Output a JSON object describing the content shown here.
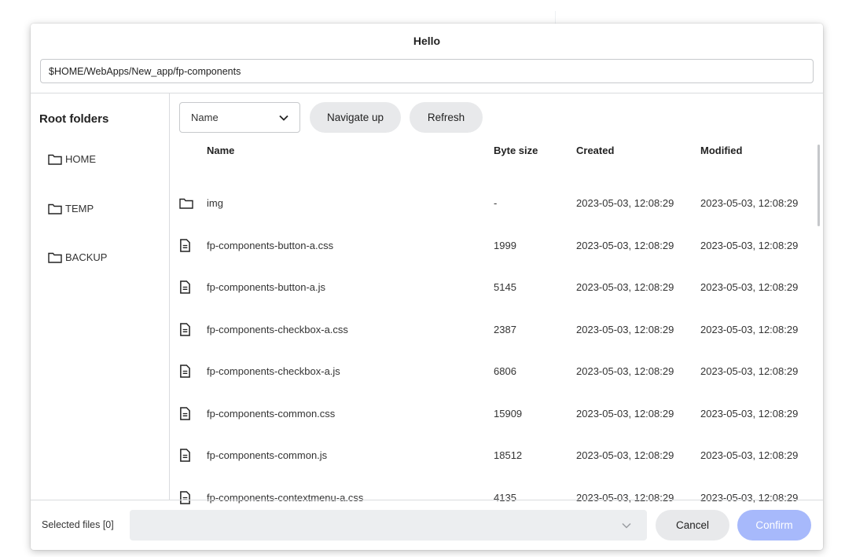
{
  "dialog": {
    "title": "Hello",
    "path_value": "$HOME/WebApps/New_app/fp-components"
  },
  "sidebar": {
    "title": "Root folders",
    "items": [
      {
        "label": "HOME",
        "icon": "folder-icon"
      },
      {
        "label": "TEMP",
        "icon": "folder-icon"
      },
      {
        "label": "BACKUP",
        "icon": "folder-icon"
      }
    ]
  },
  "toolbar": {
    "sort_value": "Name",
    "navigate_up_label": "Navigate up",
    "refresh_label": "Refresh"
  },
  "table": {
    "headers": {
      "name": "Name",
      "size": "Byte size",
      "created": "Created",
      "modified": "Modified"
    },
    "rows": [
      {
        "type": "folder",
        "name": "img",
        "size": "-",
        "created": "2023-05-03, 12:08:29",
        "modified": "2023-05-03, 12:08:29"
      },
      {
        "type": "file",
        "name": "fp-components-button-a.css",
        "size": "1999",
        "created": "2023-05-03, 12:08:29",
        "modified": "2023-05-03, 12:08:29"
      },
      {
        "type": "file",
        "name": "fp-components-button-a.js",
        "size": "5145",
        "created": "2023-05-03, 12:08:29",
        "modified": "2023-05-03, 12:08:29"
      },
      {
        "type": "file",
        "name": "fp-components-checkbox-a.css",
        "size": "2387",
        "created": "2023-05-03, 12:08:29",
        "modified": "2023-05-03, 12:08:29"
      },
      {
        "type": "file",
        "name": "fp-components-checkbox-a.js",
        "size": "6806",
        "created": "2023-05-03, 12:08:29",
        "modified": "2023-05-03, 12:08:29"
      },
      {
        "type": "file",
        "name": "fp-components-common.css",
        "size": "15909",
        "created": "2023-05-03, 12:08:29",
        "modified": "2023-05-03, 12:08:29"
      },
      {
        "type": "file",
        "name": "fp-components-common.js",
        "size": "18512",
        "created": "2023-05-03, 12:08:29",
        "modified": "2023-05-03, 12:08:29"
      },
      {
        "type": "file",
        "name": "fp-components-contextmenu-a.css",
        "size": "4135",
        "created": "2023-05-03, 12:08:29",
        "modified": "2023-05-03, 12:08:29"
      }
    ]
  },
  "footer": {
    "selected_label": "Selected files [0]",
    "cancel_label": "Cancel",
    "confirm_label": "Confirm"
  },
  "colors": {
    "confirm_disabled": "#a7b9fb",
    "pill_button": "#e8e9eb"
  }
}
